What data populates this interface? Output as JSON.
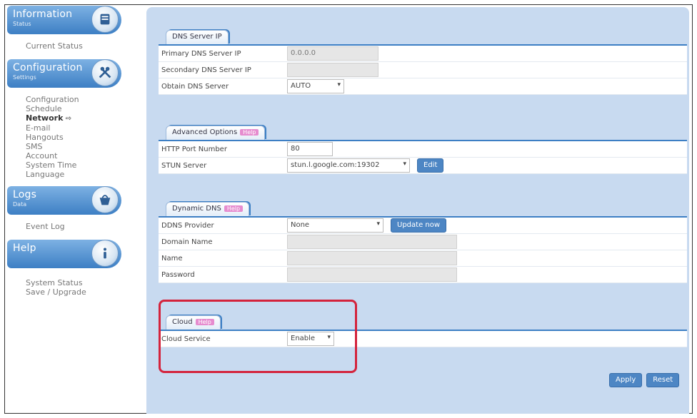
{
  "sidebar": {
    "information": {
      "title": "Information",
      "sub": "Status",
      "icon": "notepad-icon",
      "links": [
        "Current Status"
      ]
    },
    "configuration": {
      "title": "Configuration",
      "sub": "Settings",
      "icon": "tools-icon",
      "links": [
        "Configuration",
        "Schedule",
        "Network",
        "E-mail",
        "Hangouts",
        "SMS",
        "Account",
        "System Time",
        "Language"
      ],
      "active": "Network"
    },
    "logs": {
      "title": "Logs",
      "sub": "Data",
      "icon": "basket-icon",
      "links": [
        "Event Log"
      ]
    },
    "help": {
      "title": "Help",
      "sub": "",
      "icon": "info-icon",
      "links": [
        "System Status",
        "Save / Upgrade"
      ]
    }
  },
  "dns": {
    "tab": "DNS Server IP",
    "primary_label": "Primary DNS Server IP",
    "primary_value": "0.0.0.0",
    "secondary_label": "Secondary DNS Server IP",
    "secondary_value": "",
    "obtain_label": "Obtain DNS Server",
    "obtain_value": "AUTO"
  },
  "advanced": {
    "tab": "Advanced Options",
    "help": "Help",
    "http_label": "HTTP Port Number",
    "http_value": "80",
    "stun_label": "STUN Server",
    "stun_value": "stun.l.google.com:19302",
    "edit_label": "Edit"
  },
  "ddns": {
    "tab": "Dynamic DNS",
    "help": "Help",
    "provider_label": "DDNS Provider",
    "provider_value": "None",
    "update_label": "Update now",
    "domain_label": "Domain Name",
    "domain_value": "",
    "name_label": "Name",
    "name_value": "",
    "password_label": "Password",
    "password_value": ""
  },
  "cloud": {
    "tab": "Cloud",
    "help": "Help",
    "service_label": "Cloud Service",
    "service_value": "Enable"
  },
  "actions": {
    "apply": "Apply",
    "reset": "Reset"
  },
  "colors": {
    "accent": "#3d7fc4",
    "panel": "#c8daf0",
    "highlight": "#d4233c",
    "help_tag": "#e68ccf"
  }
}
